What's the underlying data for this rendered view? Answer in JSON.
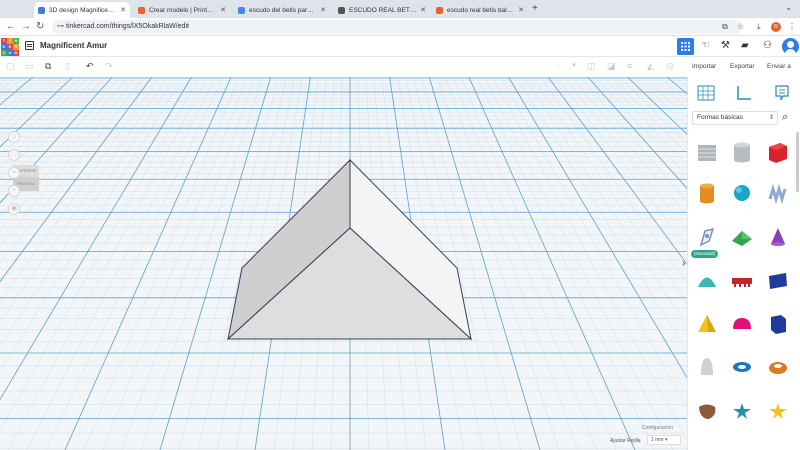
{
  "browser": {
    "tabs": [
      {
        "title": "3D design Magnificent Amur",
        "favicon_color": "#3c7be2",
        "active": true
      },
      {
        "title": "Crear modelo | Printables.co",
        "favicon_color": "#e8652a",
        "active": false
      },
      {
        "title": "escudo del betis para imprim",
        "favicon_color": "#4285f4",
        "active": false
      },
      {
        "title": "ESCUDO REAL BETIS BALOM",
        "favicon_color": "#555555",
        "active": false
      },
      {
        "title": "escudo real betis balompié p",
        "favicon_color": "#e8652a",
        "active": false
      }
    ],
    "new_tab": "+",
    "url": "tinkercad.com/things/lX5OkakRlaW/edit",
    "profile_initial": "R"
  },
  "app": {
    "logo_letters": [
      "T",
      "I",
      "N",
      "K",
      "E",
      "R",
      "C",
      "A",
      "D"
    ],
    "logo_colors": [
      "#e2424b",
      "#f09a2e",
      "#43b049",
      "#2b7de9",
      "#e2424b",
      "#f09a2e",
      "#43b049",
      "#2b7de9",
      "#e2424b"
    ],
    "project_title": "Magnificent Amur"
  },
  "toolbar": {
    "import": "Importar",
    "export": "Exportar",
    "send": "Enviar a"
  },
  "viewcube": {
    "top": "SUPERIOR",
    "front": "FRONTAL"
  },
  "workplane": {
    "settings": "Configuración",
    "snap_grid_label": "Ajustar Rejilla",
    "snap_grid_value": "1 mm"
  },
  "panel": {
    "library": "Formas básicas",
    "new_badge": "(Novedad)",
    "shapes": [
      {
        "name": "box-striped",
        "color": "#b0b4bb"
      },
      {
        "name": "cylinder-striped",
        "color": "#b8bcc2"
      },
      {
        "name": "box",
        "color": "#d8232a"
      },
      {
        "name": "cylinder",
        "color": "#e58a1f"
      },
      {
        "name": "sphere",
        "color": "#1aa6c9"
      },
      {
        "name": "scribble",
        "color": "#8fa8d8"
      },
      {
        "name": "shape-generator",
        "color": "#7d8fc9"
      },
      {
        "name": "roof",
        "color": "#2ea84a"
      },
      {
        "name": "cone",
        "color": "#8b3fb8"
      },
      {
        "name": "round-roof",
        "color": "#3fb6b6"
      },
      {
        "name": "text",
        "color": "#c8232a"
      },
      {
        "name": "wedge",
        "color": "#1f3c9c"
      },
      {
        "name": "pyramid",
        "color": "#f2c21b"
      },
      {
        "name": "half-sphere",
        "color": "#e0107b"
      },
      {
        "name": "polygon",
        "color": "#1f3c9c"
      },
      {
        "name": "paraboloid",
        "color": "#d0d0d0"
      },
      {
        "name": "torus",
        "color": "#1a78c9"
      },
      {
        "name": "tube",
        "color": "#e0781f"
      },
      {
        "name": "organic-shape",
        "color": "#8a5a3a"
      },
      {
        "name": "star",
        "color": "#2a8fb0"
      },
      {
        "name": "star-yellow",
        "color": "#f2c21b"
      }
    ]
  }
}
